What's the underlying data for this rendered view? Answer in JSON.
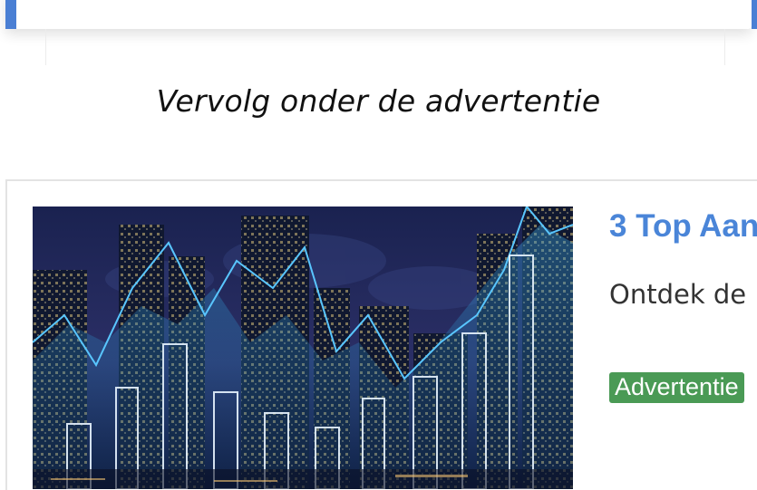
{
  "continue_note": "Vervolg onder de advertentie",
  "ad": {
    "title": "3 Top Aan",
    "description": "Ontdek de I",
    "badge": "Advertentie",
    "image_icon": "city-finance-chart-image"
  },
  "colors": {
    "accent_blue": "#4a85d8",
    "badge_green": "#4a9a55",
    "card_edge_blue": "#4a7fd4"
  }
}
